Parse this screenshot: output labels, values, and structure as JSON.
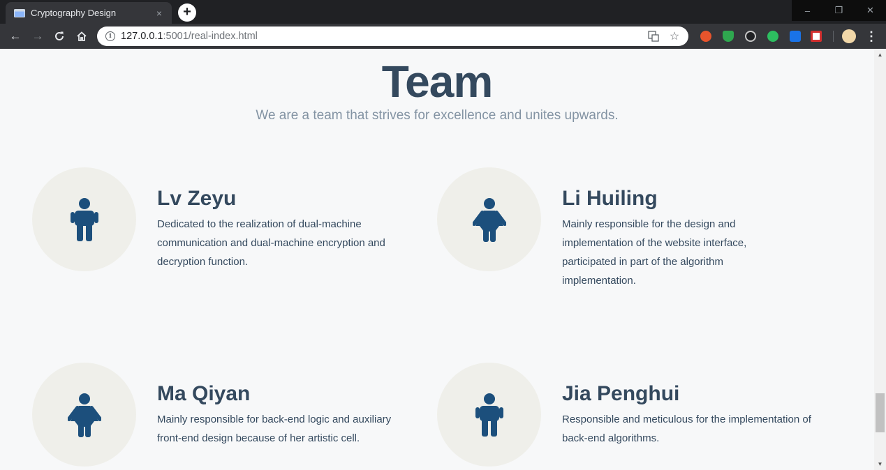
{
  "browser": {
    "tab_title": "Cryptography Design",
    "tab_close": "×",
    "new_tab": "+",
    "url_host": "127.0.0.1",
    "url_rest": ":5001/real-index.html",
    "window_controls": {
      "minimize": "–",
      "restore": "❐",
      "close": "✕"
    },
    "nav": {
      "back": "←",
      "forward": "→",
      "reload": "C",
      "home": "⌂"
    }
  },
  "page": {
    "title": "Team",
    "subtitle": "We are a team that strives for excellence and unites upwards.",
    "members": [
      {
        "name": "Lv Zeyu",
        "icon": "male-person-icon",
        "description": "Dedicated to the realization of dual-machine communication and dual-machine encryption and decryption function."
      },
      {
        "name": "Li Huiling",
        "icon": "female-person-icon",
        "description": "Mainly responsible for the design and implementation of the website interface, participated in part of the algorithm implementation."
      },
      {
        "name": "Ma Qiyan",
        "icon": "female-person-icon",
        "description": "Mainly responsible for back-end logic and auxiliary front-end design because of her artistic cell."
      },
      {
        "name": "Jia Penghui",
        "icon": "male-person-icon",
        "description": "Responsible and meticulous for the implementation of back-end algorithms."
      }
    ]
  },
  "colors": {
    "heading": "#34495e",
    "subtitle": "#8393a3",
    "icon": "#1c4f7c",
    "avatar_bg": "#efefea",
    "page_bg": "#f7f8f9"
  }
}
